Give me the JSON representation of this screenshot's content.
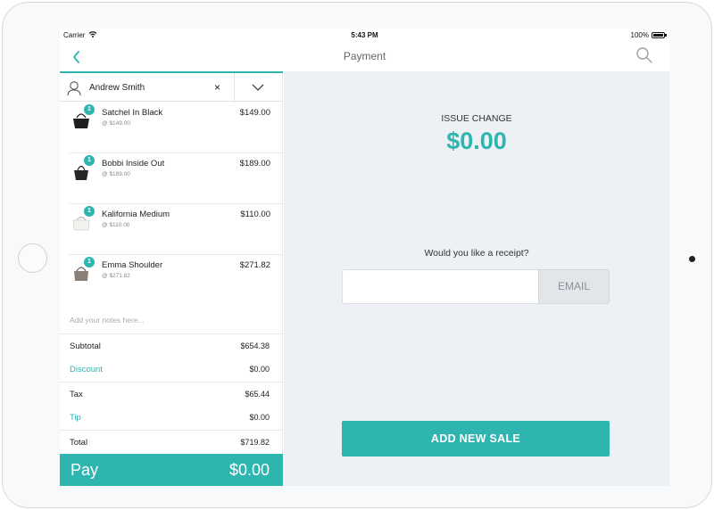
{
  "status_bar": {
    "carrier": "Carrier",
    "time": "5:43 PM",
    "battery": "100%",
    "icons": [
      "wifi-icon",
      "battery-icon"
    ]
  },
  "nav": {
    "title": "Payment",
    "back_icon": "chevron-left-icon",
    "search_icon": "search-icon"
  },
  "customer": {
    "name": "Andrew Smith",
    "clear_glyph": "×",
    "icons": [
      "user-icon",
      "chevron-down-icon"
    ]
  },
  "cart": {
    "items": [
      {
        "name": "Satchel In Black",
        "unit_price": "@ $149.00",
        "price": "$149.00",
        "qty": "1",
        "icon": "black-satchel-bag-icon"
      },
      {
        "name": "Bobbi Inside Out",
        "unit_price": "@ $189.00",
        "price": "$189.00",
        "qty": "1",
        "icon": "black-tote-bag-icon"
      },
      {
        "name": "Kalifornia Medium",
        "unit_price": "@ $110.00",
        "price": "$110.00",
        "qty": "1",
        "icon": "white-bag-icon"
      },
      {
        "name": "Emma Shoulder",
        "unit_price": "@ $271.82",
        "price": "$271.82",
        "qty": "1",
        "icon": "taupe-shoulder-bag-icon"
      }
    ],
    "notes_placeholder": "Add your notes here..."
  },
  "summary": {
    "subtotal_label": "Subtotal",
    "subtotal": "$654.38",
    "discount_label": "Discount",
    "discount": "$0.00",
    "tax_label": "Tax",
    "tax": "$65.44",
    "tip_label": "Tip",
    "tip": "$0.00",
    "total_label": "Total",
    "total": "$719.82"
  },
  "pay": {
    "label": "Pay",
    "amount": "$0.00"
  },
  "payment_panel": {
    "issue_change_label": "ISSUE CHANGE",
    "change_amount": "$0.00",
    "receipt_prompt": "Would you like a receipt?",
    "email_placeholder": "",
    "email_button": "EMAIL",
    "add_new_sale": "ADD NEW SALE"
  },
  "colors": {
    "accent": "#2eb5b0",
    "panel_background": "#edf0f4"
  }
}
